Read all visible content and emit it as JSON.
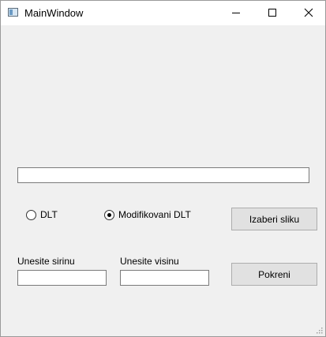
{
  "window": {
    "title": "MainWindow",
    "icon": "app-window-icon"
  },
  "titlebar": {
    "minimize_icon": "minimize-icon",
    "maximize_icon": "maximize-icon",
    "close_icon": "close-icon"
  },
  "progress": {
    "value": ""
  },
  "method": {
    "options": [
      {
        "label": "DLT",
        "checked": false
      },
      {
        "label": "Modifikovani DLT",
        "checked": true
      }
    ]
  },
  "buttons": {
    "choose_image": "Izaberi sliku",
    "run": "Pokreni"
  },
  "inputs": {
    "width_label": "Unesite sirinu",
    "width_value": "",
    "height_label": "Unesite visinu",
    "height_value": ""
  }
}
